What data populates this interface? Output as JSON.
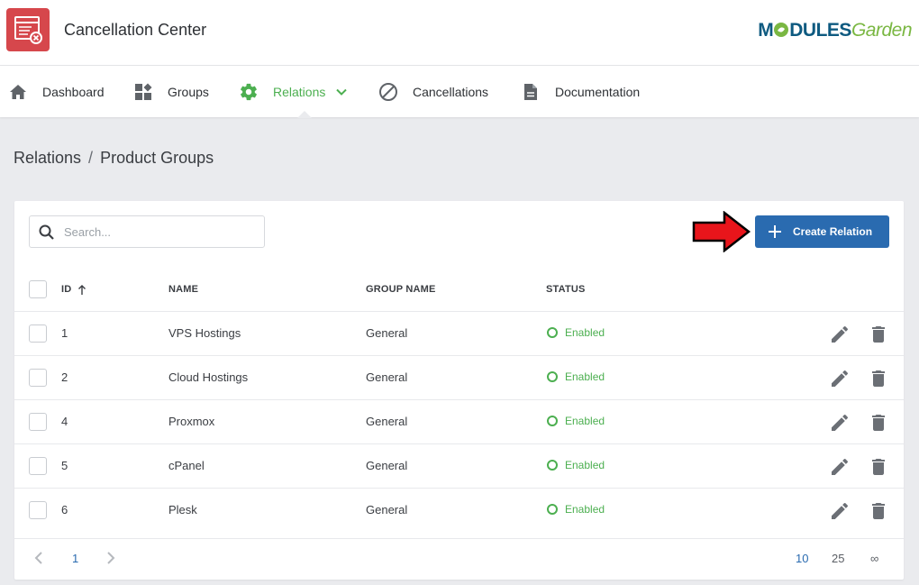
{
  "app": {
    "title": "Cancellation Center",
    "brand_part1": "M  DULES",
    "brand_part2": "Garden",
    "brand_o_color": "#7ab742",
    "logo_color": "#d6474c"
  },
  "nav": [
    {
      "label": "Dashboard",
      "icon": "home-icon"
    },
    {
      "label": "Groups",
      "icon": "widgets-icon"
    },
    {
      "label": "Relations",
      "icon": "gear-icon",
      "active": true
    },
    {
      "label": "Cancellations",
      "icon": "block-icon"
    },
    {
      "label": "Documentation",
      "icon": "document-icon"
    }
  ],
  "breadcrumb": {
    "parent": "Relations",
    "separator": "/",
    "current": "Product Groups"
  },
  "toolbar": {
    "search_placeholder": "Search...",
    "create_label": "Create Relation",
    "accent": "#2a6bb0"
  },
  "table": {
    "headers": {
      "id": "ID",
      "name": "NAME",
      "group": "GROUP NAME",
      "status": "STATUS"
    },
    "sort": {
      "column": "ID",
      "direction": "asc"
    },
    "rows": [
      {
        "id": "1",
        "name": "VPS Hostings",
        "group": "General",
        "status": "Enabled"
      },
      {
        "id": "2",
        "name": "Cloud Hostings",
        "group": "General",
        "status": "Enabled"
      },
      {
        "id": "4",
        "name": "Proxmox",
        "group": "General",
        "status": "Enabled"
      },
      {
        "id": "5",
        "name": "cPanel",
        "group": "General",
        "status": "Enabled"
      },
      {
        "id": "6",
        "name": "Plesk",
        "group": "General",
        "status": "Enabled"
      }
    ],
    "status_color": "#4caf50"
  },
  "pagination": {
    "current_page": "1",
    "sizes": [
      "10",
      "25",
      "∞"
    ],
    "active_size": "10"
  }
}
